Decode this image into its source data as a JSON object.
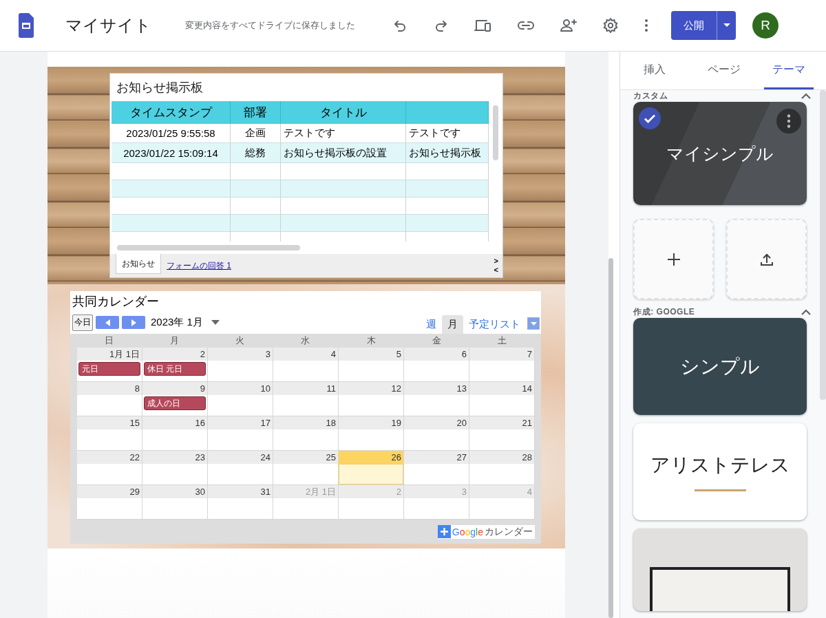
{
  "header": {
    "site_title": "マイサイト",
    "save_status": "変更内容をすべてドライブに保存しました",
    "publish_label": "公開",
    "avatar_letter": "R"
  },
  "sheet": {
    "title": "お知らせ掲示板",
    "columns": [
      "タイムスタンプ",
      "部署",
      "タイトル"
    ],
    "rows": [
      {
        "cells": [
          "2023/01/25 9:55:58",
          "企画",
          "テストです",
          "テストです"
        ]
      },
      {
        "cells": [
          "2023/01/22 15:09:14",
          "総務",
          "お知らせ掲示板の設置",
          "お知らせ掲示板"
        ]
      }
    ],
    "tabs": [
      {
        "label": "お知らせ",
        "selected": true
      },
      {
        "label": "フォームの回答 1",
        "selected": false
      }
    ],
    "next_label": ">",
    "prev_label": "<"
  },
  "calendar": {
    "title": "共同カレンダー",
    "today_button": "今日",
    "month_label": "2023年 1月",
    "views": [
      {
        "label": "週",
        "selected": false
      },
      {
        "label": "月",
        "selected": true
      },
      {
        "label": "予定リスト",
        "selected": false
      }
    ],
    "weekdays": [
      "日",
      "月",
      "火",
      "水",
      "木",
      "金",
      "土"
    ],
    "weeks": [
      {
        "days": [
          {
            "label": "1月 1日",
            "other_month": false,
            "today": false,
            "events": [
              "元日"
            ]
          },
          {
            "label": "2",
            "other_month": false,
            "today": false,
            "events": [
              "休日 元日"
            ]
          },
          {
            "label": "3",
            "other_month": false,
            "today": false
          },
          {
            "label": "4",
            "other_month": false,
            "today": false
          },
          {
            "label": "5",
            "other_month": false,
            "today": false
          },
          {
            "label": "6",
            "other_month": false,
            "today": false
          },
          {
            "label": "7",
            "other_month": false,
            "today": false
          }
        ]
      },
      {
        "days": [
          {
            "label": "8",
            "other_month": false,
            "today": false
          },
          {
            "label": "9",
            "other_month": false,
            "today": false,
            "events": [
              "成人の日"
            ]
          },
          {
            "label": "10",
            "other_month": false,
            "today": false
          },
          {
            "label": "11",
            "other_month": false,
            "today": false
          },
          {
            "label": "12",
            "other_month": false,
            "today": false
          },
          {
            "label": "13",
            "other_month": false,
            "today": false
          },
          {
            "label": "14",
            "other_month": false,
            "today": false
          }
        ]
      },
      {
        "days": [
          {
            "label": "15",
            "other_month": false,
            "today": false
          },
          {
            "label": "16",
            "other_month": false,
            "today": false
          },
          {
            "label": "17",
            "other_month": false,
            "today": false
          },
          {
            "label": "18",
            "other_month": false,
            "today": false
          },
          {
            "label": "19",
            "other_month": false,
            "today": false
          },
          {
            "label": "20",
            "other_month": false,
            "today": false
          },
          {
            "label": "21",
            "other_month": false,
            "today": false
          }
        ]
      },
      {
        "days": [
          {
            "label": "22",
            "other_month": false,
            "today": false
          },
          {
            "label": "23",
            "other_month": false,
            "today": false
          },
          {
            "label": "24",
            "other_month": false,
            "today": false
          },
          {
            "label": "25",
            "other_month": false,
            "today": false
          },
          {
            "label": "26",
            "other_month": false,
            "today": true
          },
          {
            "label": "27",
            "other_month": false,
            "today": false
          },
          {
            "label": "28",
            "other_month": false,
            "today": false
          }
        ]
      },
      {
        "days": [
          {
            "label": "29",
            "other_month": false,
            "today": false
          },
          {
            "label": "30",
            "other_month": false,
            "today": false
          },
          {
            "label": "31",
            "other_month": false,
            "today": false
          },
          {
            "label": "2月 1日",
            "other_month": true,
            "today": false
          },
          {
            "label": "2",
            "other_month": true,
            "today": false
          },
          {
            "label": "3",
            "other_month": true,
            "today": false
          },
          {
            "label": "4",
            "other_month": true,
            "today": false
          }
        ]
      }
    ],
    "footer_brand": "Google",
    "footer_label": "カレンダー"
  },
  "panel": {
    "tabs": [
      {
        "label": "挿入",
        "selected": false
      },
      {
        "label": "ページ",
        "selected": false
      },
      {
        "label": "テーマ",
        "selected": true
      }
    ],
    "sections": [
      {
        "heading": "カスタム",
        "expanded": true,
        "themes": [
          {
            "kind": "custom",
            "name": "マイシンプル",
            "selected": true
          }
        ],
        "tiles": [
          {
            "kind": "add"
          },
          {
            "kind": "upload"
          }
        ]
      },
      {
        "heading": "作成: GOOGLE",
        "expanded": true,
        "themes": [
          {
            "kind": "dark",
            "name": "シンプル",
            "selected": false
          },
          {
            "kind": "light",
            "name": "アリストテレス",
            "selected": false
          },
          {
            "kind": "framed",
            "selected": false
          }
        ]
      }
    ]
  }
}
